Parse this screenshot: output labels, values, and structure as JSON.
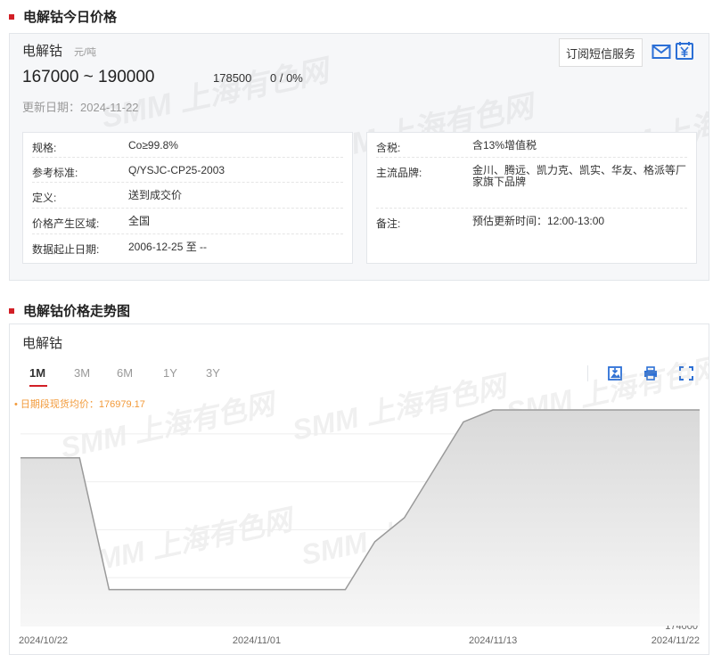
{
  "section1_title": "电解钴今日价格",
  "section2_title": "电解钴价格走势图",
  "watermark": "SMM 上海有色网",
  "product": {
    "name": "电解钴",
    "unit": "元/吨",
    "price_range": "167000 ~ 190000",
    "average": "178500",
    "change": "0 / 0%",
    "update_date": "更新日期：2024-11-22"
  },
  "subscribe_label": "订阅短信服务",
  "info_left": [
    {
      "key": "规格:",
      "value": "Co≥99.8%"
    },
    {
      "key": "参考标准:",
      "value": "Q/YSJC-CP25-2003"
    },
    {
      "key": "定义:",
      "value": "送到成交价"
    },
    {
      "key": "价格产生区域:",
      "value": "全国"
    },
    {
      "key": "数据起止日期:",
      "value": "2006-12-25 至 --"
    }
  ],
  "info_right": [
    {
      "key": "含税:",
      "value": "含13%增值税"
    },
    {
      "key": "主流品牌:",
      "value": "金川、腾远、凯力克、凯实、华友、格派等厂家旗下品牌"
    },
    {
      "key": "备注:",
      "value": "预估更新时间：12:00-13:00"
    }
  ],
  "chart_title": "电解钴",
  "range_tabs": [
    "1M",
    "3M",
    "6M",
    "1Y",
    "3Y"
  ],
  "active_tab": "1M",
  "avg_legend": "日期段现货均价：176979.17",
  "colors": {
    "accent": "#d21f26",
    "legend": "#f29a3a",
    "line": "#9a9a9a"
  },
  "chart_data": {
    "type": "area",
    "title": "电解钴",
    "x": [
      "2024/10/22",
      "2024/10/23",
      "2024/10/24",
      "2024/10/25",
      "2024/10/28",
      "2024/10/29",
      "2024/10/30",
      "2024/10/31",
      "2024/11/01",
      "2024/11/04",
      "2024/11/05",
      "2024/11/06",
      "2024/11/07",
      "2024/11/08",
      "2024/11/11",
      "2024/11/12",
      "2024/11/13",
      "2024/11/14",
      "2024/11/15",
      "2024/11/18",
      "2024/11/19",
      "2024/11/20",
      "2024/11/21",
      "2024/11/22"
    ],
    "values": [
      177500,
      177500,
      177500,
      174750,
      174750,
      174750,
      174750,
      174750,
      174750,
      174750,
      174750,
      174750,
      175750,
      176250,
      177250,
      178250,
      178500,
      178500,
      178500,
      178500,
      178500,
      178500,
      178500,
      178500
    ],
    "x_tick_labels": [
      "2024/10/22",
      "2024/11/01",
      "2024/11/13",
      "2024/11/22"
    ],
    "y_ticks": [
      174000,
      175000,
      176000,
      177000,
      178000
    ],
    "ylim": [
      174000,
      178500
    ],
    "grid": true,
    "legend": "top-left"
  }
}
